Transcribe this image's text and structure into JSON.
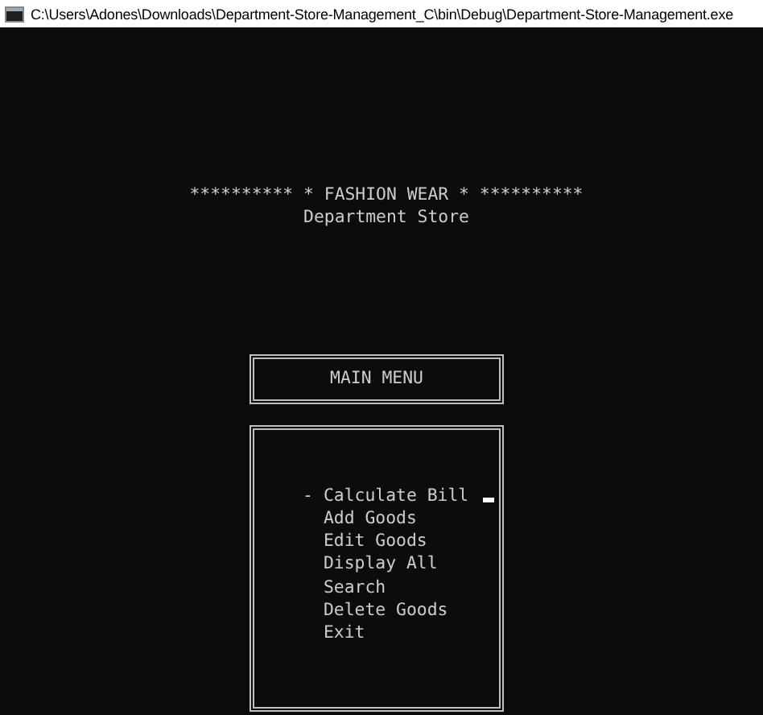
{
  "window": {
    "title": "C:\\Users\\Adones\\Downloads\\Department-Store-Management_C\\bin\\Debug\\Department-Store-Management.exe"
  },
  "banner": {
    "title": "********** * FASHION WEAR * **********",
    "subtitle": "Department Store"
  },
  "menu_header": "MAIN MENU",
  "menu": {
    "marker": "-",
    "items": [
      {
        "label": "Calculate Bill",
        "selected": true
      },
      {
        "label": "Add Goods",
        "selected": false
      },
      {
        "label": "Edit Goods",
        "selected": false
      },
      {
        "label": "Display All",
        "selected": false
      },
      {
        "label": "Search",
        "selected": false
      },
      {
        "label": "Delete Goods",
        "selected": false
      },
      {
        "label": "Exit",
        "selected": false
      }
    ]
  }
}
